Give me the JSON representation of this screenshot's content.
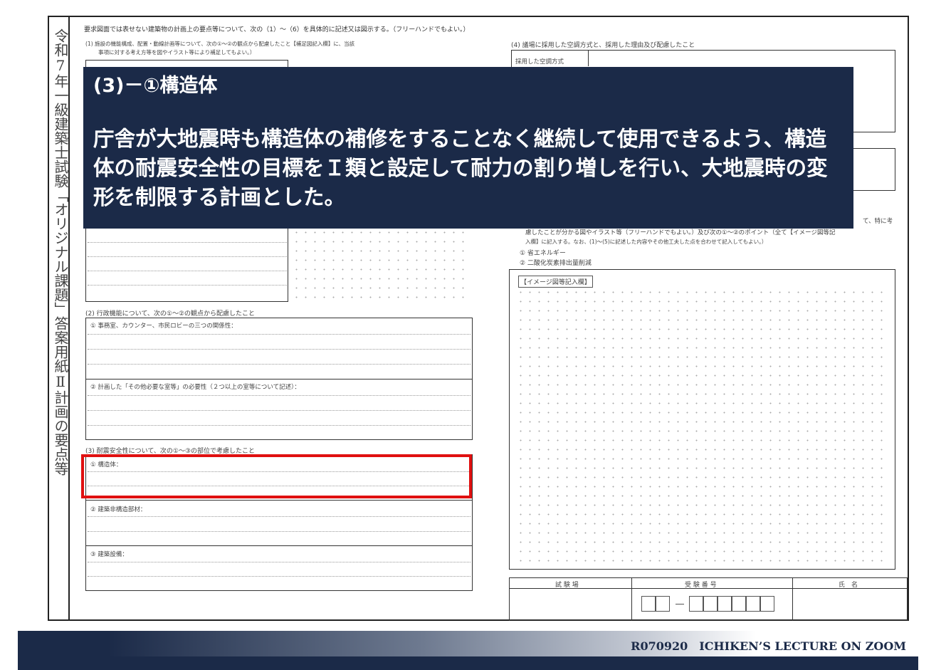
{
  "sheet": {
    "side_title": "令和7年一級建築士試験「オリジナル課題」答案用紙Ⅱ計画の要点等",
    "header": "要求図面では表せない建築物の計画上の要点等について、次の（1）〜（6）を具体的に記述又は図示する。（フリーハンドでもよい。）",
    "q1": "(1) 施設の機能構成、配置・動線計画等について、次の①〜②の観点から配慮したこと【補足図記入欄】に、当該",
    "q1_sub": "事項に対する考え方等を図やイラスト等により補足してもよい。）",
    "q2": "(2) 行政機能について、次の①〜②の観点から配慮したこと",
    "q2_1": "① 事務室、カウンター、市民ロビーの三つの関係性：",
    "q2_2": "② 計画した「その他必要な室等」の必要性（２つ以上の室等について記述）：",
    "q3": "(3) 耐震安全性について、次の①〜③の部位で考慮したこと",
    "q3_1": "① 構造体：",
    "q3_2": "② 建築非構造部材：",
    "q3_3": "③ 建築設備：",
    "q4": "(4) 議場に採用した空調方式と、採用した理由及び配慮したこと",
    "q4_label": "採用した空調方式",
    "q6_a": "て、特に考",
    "q6_b": "慮したことが分かる図やイラスト等（フリーハンドでもよい。）及び次の①〜②のポイント（全て【イメージ図等記",
    "q6_c": "入欄】に記入する。なお、(1)〜(5)に記述した内容やその他工夫した点を合わせて記入してもよい。）",
    "q6_1": "① 省エネルギー",
    "q6_2": "② 二酸化炭素排出量削減",
    "image_label": "【イメージ図等記入欄】",
    "exam_site": "試 験 場",
    "exam_number": "受 験 番 号",
    "name": "氏　名"
  },
  "overlay": {
    "title": "(3)－①構造体",
    "body": "庁舎が大地震時も構造体の補修をすることなく継続して使用できるよう、構造体の耐震安全性の目標をＩ類と設定して耐力の割り増しを行い、大地震時の変形を制限する計画とした。"
  },
  "footer": {
    "text": "R070920　ICHIKEN’S LECTURE ON ZOOM"
  },
  "colors": {
    "navy": "#1b2a48",
    "highlight": "#e01010"
  }
}
